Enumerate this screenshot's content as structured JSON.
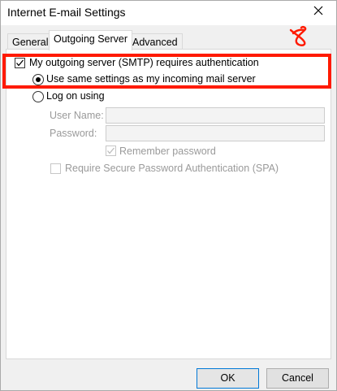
{
  "window": {
    "title": "Internet E-mail Settings"
  },
  "tabs": [
    {
      "label": "General",
      "active": false
    },
    {
      "label": "Outgoing Server",
      "active": true
    },
    {
      "label": "Advanced",
      "active": false
    }
  ],
  "outgoing": {
    "requires_auth": {
      "label": "My outgoing server (SMTP) requires authentication",
      "checked": true
    },
    "use_same_settings": {
      "label": "Use same settings as my incoming mail server",
      "selected": true
    },
    "log_on_using": {
      "label": "Log on using",
      "selected": false
    },
    "user_name": {
      "label": "User Name:",
      "value": ""
    },
    "password": {
      "label": "Password:",
      "value": ""
    },
    "remember_password": {
      "label": "Remember password",
      "checked": true,
      "enabled": false
    },
    "spa": {
      "label": "Require Secure Password Authentication (SPA)",
      "checked": false,
      "enabled": false
    }
  },
  "annotation": {
    "number": "8",
    "color": "#ff1a00"
  },
  "buttons": {
    "ok": "OK",
    "cancel": "Cancel"
  }
}
